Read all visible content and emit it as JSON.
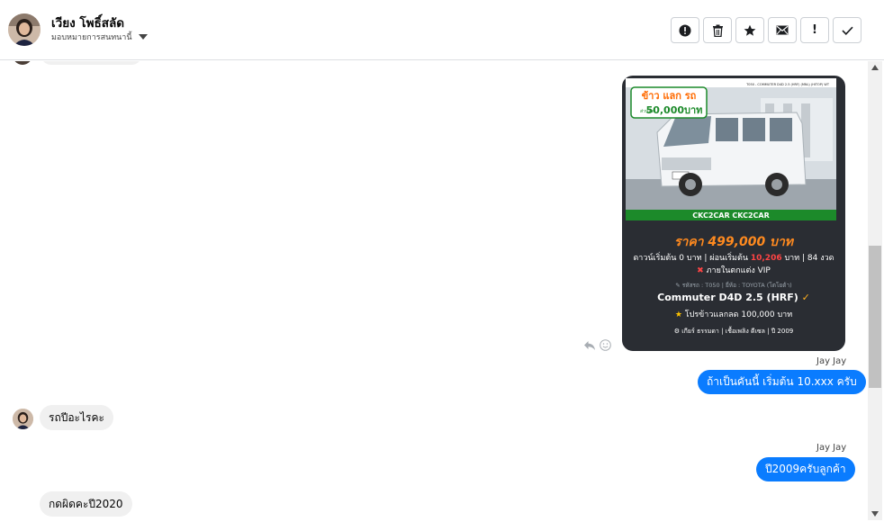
{
  "header": {
    "contact_name": "เวียง โพธิ์สลัด",
    "assign_label": "มอบหมายการสนทนานี้",
    "actions": [
      {
        "name": "report-icon",
        "label": ""
      },
      {
        "name": "trash-icon",
        "label": ""
      },
      {
        "name": "star-icon",
        "label": ""
      },
      {
        "name": "mail-icon",
        "label": ""
      },
      {
        "name": "exclamation-icon",
        "label": "!"
      },
      {
        "name": "check-icon",
        "label": ""
      }
    ]
  },
  "card": {
    "banner_text": "CKC2CAR CKC2CAR",
    "promo_banner_line1": "ข้าว แลก รถ",
    "promo_banner_small": "ส่วนลด",
    "promo_banner_amount": "50,000บาท",
    "model_tag": "T050 - COMMUTER D4D 2.5 (HRF) (MNL) (HITOP) WT",
    "price": "ราคา 499,000 บาท",
    "terms_prefix": "ดาวน์เริ่มต้น 0 บาท | ผ่อนเริ่มต้น",
    "terms_highlight": "10,206",
    "terms_suffix": "บาท | 84 งวด",
    "vip_text": "ภายในตกแต่ง VIP",
    "meta": "รหัสรถ : T050 | ยี่ห้อ : TOYOTA (โตโยต้า)",
    "model": "Commuter D4D 2.5 (HRF)",
    "promo": "โปรข้าวแลกลด 100,000 บาท",
    "spec": "เกียร์ ธรรมดา  |  เชื้อเพลิง ดีเซล  |  ปี 2009"
  },
  "messages": [
    {
      "id": "m1",
      "sender": "Jay Jay",
      "text": "ถ้าเป็นคันนี้ เริ่มต้น 10.xxx ครับ"
    },
    {
      "id": "m2",
      "text": "รถปีอะไรคะ"
    },
    {
      "id": "m3",
      "sender": "Jay Jay",
      "text": "ปี2009ครับลูกค้า"
    },
    {
      "id": "m4",
      "text": "กดผิดคะปี2020"
    }
  ],
  "colors": {
    "outgoing_bubble": "#0a7cff",
    "incoming_bubble": "#f0f0f0",
    "card_bg": "#2a2d33",
    "price_orange": "#ff8a1f"
  }
}
